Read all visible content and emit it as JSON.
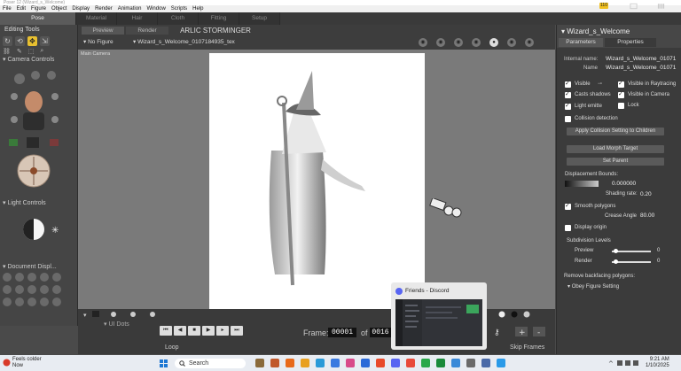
{
  "window": {
    "title": "Poser 12 (Wizard_s_Welcome)"
  },
  "menu": [
    "File",
    "Edit",
    "Figure",
    "Object",
    "Display",
    "Render",
    "Animation",
    "Window",
    "Scripts",
    "Help"
  ],
  "rooms": [
    "Pose",
    "Material",
    "Hair",
    "Cloth",
    "Fitting",
    "Setup"
  ],
  "notification_count": "110",
  "left_panel": {
    "editing_tools": "Editing Tools",
    "camera_controls": "Camera Controls",
    "light_controls": "Light Controls",
    "document_display": "Document Displ...",
    "ui_dots": "UI Dots"
  },
  "viewport": {
    "tab_preview": "Preview",
    "tab_render": "Render",
    "scene_title": "ARLIC STORMINGER",
    "figure_selector": "No Figure",
    "object_selector": "Wizard_s_Welcome_0107184935_tex",
    "camera_label": "Main Camera"
  },
  "timeline": {
    "frame_label": "Frame:",
    "frame_value": "00001",
    "of_label": "of",
    "total_value": "0016",
    "loop_label": "Loop",
    "skip_label": "Skip Frames"
  },
  "properties": {
    "title": "Wizard_s_Welcome",
    "tab_parameters": "Parameters",
    "tab_properties": "Properties",
    "internal_name_label": "Internal name:",
    "internal_name_value": "Wizard_s_Welcome_01071",
    "name_label": "Name",
    "name_value": "Wizard_s_Welcome_01071",
    "visible": "Visible",
    "visible_raytracing": "Visible in Raytracing",
    "casts_shadows": "Casts shadows",
    "visible_camera": "Visible in Camera",
    "light_emitter": "Light emitte",
    "lock": "Lock",
    "collision_detection": "Collision detection",
    "apply_collision": "Apply Collision Setting to Children",
    "load_morph": "Load Morph Target",
    "set_parent": "Set Parent",
    "displacement_bounds": "Displacement Bounds:",
    "displacement_value": "0.000000",
    "shading_rate_label": "Shading rate:",
    "shading_rate_value": "0.20",
    "smooth_polygons": "Smooth polygons",
    "crease_angle_label": "Crease Angle",
    "crease_angle_value": "80.00",
    "display_origin": "Display origin",
    "subdivision_levels": "Subdivision Levels",
    "preview_label": "Preview",
    "preview_value": "0",
    "render_label": "Render",
    "render_value": "0",
    "remove_backfacing": "Remove backfacing polygons:",
    "obey_figure": "Obey Figure Setting"
  },
  "popup": {
    "title": "Friends - Discord"
  },
  "taskbar": {
    "weather_temp": "Feels colder",
    "weather_sub": "Now",
    "search": "Search",
    "time": "9:21 AM",
    "date": "1/10/2025"
  }
}
